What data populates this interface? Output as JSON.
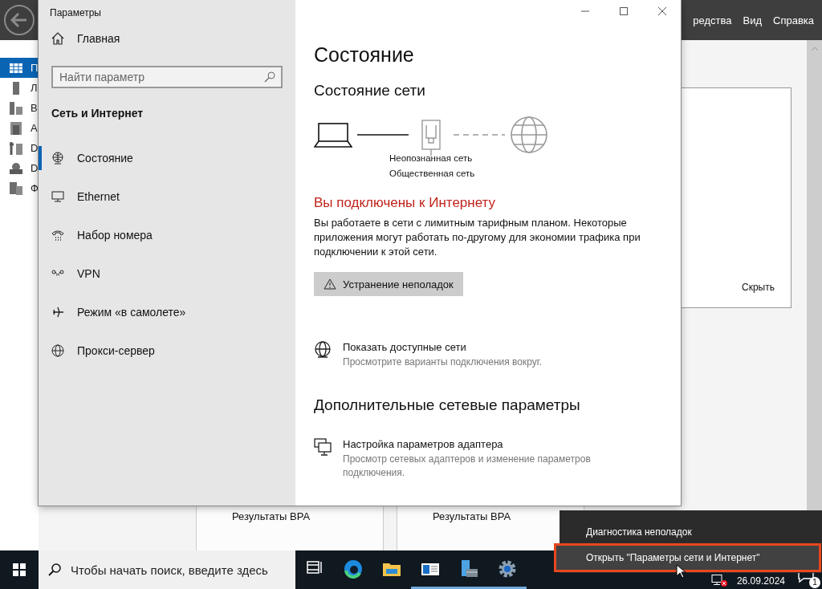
{
  "background_app": {
    "menu": [
      "редства",
      "Вид",
      "Справка"
    ],
    "nav_items": [
      {
        "label": "П",
        "selected": true
      },
      {
        "label": "Л",
        "selected": false
      },
      {
        "label": "В",
        "selected": false
      },
      {
        "label": "А",
        "selected": false
      },
      {
        "label": "D",
        "selected": false
      },
      {
        "label": "D",
        "selected": false
      },
      {
        "label": "Ф",
        "selected": false
      }
    ],
    "panel_action": "Скрыть",
    "tiles": [
      "Результаты BPA",
      "Результаты BPA"
    ]
  },
  "settings": {
    "title": "Параметры",
    "home": "Главная",
    "search": {
      "placeholder": "Найти параметр"
    },
    "section": "Сеть и Интернет",
    "nav": [
      {
        "kind": "status",
        "label": "Состояние",
        "selected": true
      },
      {
        "kind": "ethernet",
        "label": "Ethernet",
        "selected": false
      },
      {
        "kind": "dialup",
        "label": "Набор номера",
        "selected": false
      },
      {
        "kind": "vpn",
        "label": "VPN",
        "selected": false
      },
      {
        "kind": "airplane",
        "label": "Режим «в самолете»",
        "selected": false
      },
      {
        "kind": "proxy",
        "label": "Прокси-сервер",
        "selected": false
      }
    ],
    "page_title": "Состояние",
    "network_heading": "Состояние сети",
    "network_name": "Неопознанная сеть",
    "network_profile": "Общественная сеть",
    "connection_status": "Вы подключены к Интернету",
    "message": "Вы работаете в сети с лимитным тарифным планом. Некоторые приложения могут работать по-другому для экономии трафика при подключении к этой сети.",
    "troubleshoot_button": "Устранение неполадок",
    "links": [
      {
        "kind": "networks",
        "title": "Показать доступные сети",
        "description": "Просмотрите варианты подключения вокруг."
      }
    ],
    "advanced_heading": "Дополнительные сетевые параметры",
    "advanced_links": [
      {
        "kind": "adapter",
        "title": "Настройка параметров адаптера",
        "description": "Просмотр сетевых адаптеров и изменение параметров подключения."
      }
    ]
  },
  "context_menu": {
    "items": [
      {
        "label": "Диагностика неполадок",
        "selected": false,
        "framed": false
      },
      {
        "label": "Открыть \"Параметры сети и Интернет\"",
        "selected": true,
        "framed": true
      }
    ]
  },
  "taskbar": {
    "search": {
      "placeholder": "Чтобы начать поиск, введите здесь"
    },
    "apps": [
      {
        "kind": "task-view",
        "active": false
      },
      {
        "kind": "edge",
        "active": false
      },
      {
        "kind": "explorer",
        "active": false
      },
      {
        "kind": "card",
        "active": true
      },
      {
        "kind": "server",
        "active": true
      },
      {
        "kind": "gear",
        "active": true
      }
    ],
    "date": "26.09.2024",
    "notification_count": "1"
  }
}
